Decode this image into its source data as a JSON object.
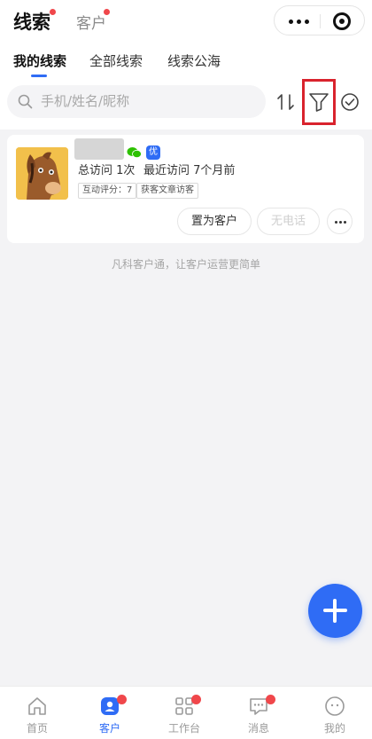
{
  "header": {
    "tabs": [
      {
        "label": "线索",
        "active": true,
        "has_dot": true
      },
      {
        "label": "客户",
        "active": false,
        "has_dot": true
      }
    ],
    "capsule_icons": [
      "more-dots-icon",
      "target-icon"
    ]
  },
  "subtabs": [
    {
      "label": "我的线索",
      "active": true
    },
    {
      "label": "全部线索",
      "active": false
    },
    {
      "label": "线索公海",
      "active": false
    }
  ],
  "search": {
    "placeholder": "手机/姓名/昵称"
  },
  "toolbar_icons": [
    "sort-icon",
    "filter-icon",
    "check-circle-icon"
  ],
  "lead_card": {
    "badge": "优",
    "stats": [
      {
        "label": "总访问",
        "value": "1次"
      },
      {
        "label": "最近访问",
        "value": "7个月前"
      }
    ],
    "tags": [
      "互动评分：7",
      "获客文章访客"
    ],
    "buttons": {
      "primary": "置为客户",
      "disabled": "无电话"
    }
  },
  "footer_note": "凡科客户通，让客户运营更简单",
  "bottom_nav": [
    {
      "label": "首页",
      "icon": "home-icon",
      "active": false,
      "has_dot": false
    },
    {
      "label": "客户",
      "icon": "customer-icon",
      "active": true,
      "has_dot": true
    },
    {
      "label": "工作台",
      "icon": "grid-icon",
      "active": false,
      "has_dot": true
    },
    {
      "label": "消息",
      "icon": "message-icon",
      "active": false,
      "has_dot": true
    },
    {
      "label": "我的",
      "icon": "profile-icon",
      "active": false,
      "has_dot": false
    }
  ],
  "colors": {
    "accent": "#2f6cf5",
    "highlight_box": "#d9232d",
    "dot": "#f0474b"
  }
}
